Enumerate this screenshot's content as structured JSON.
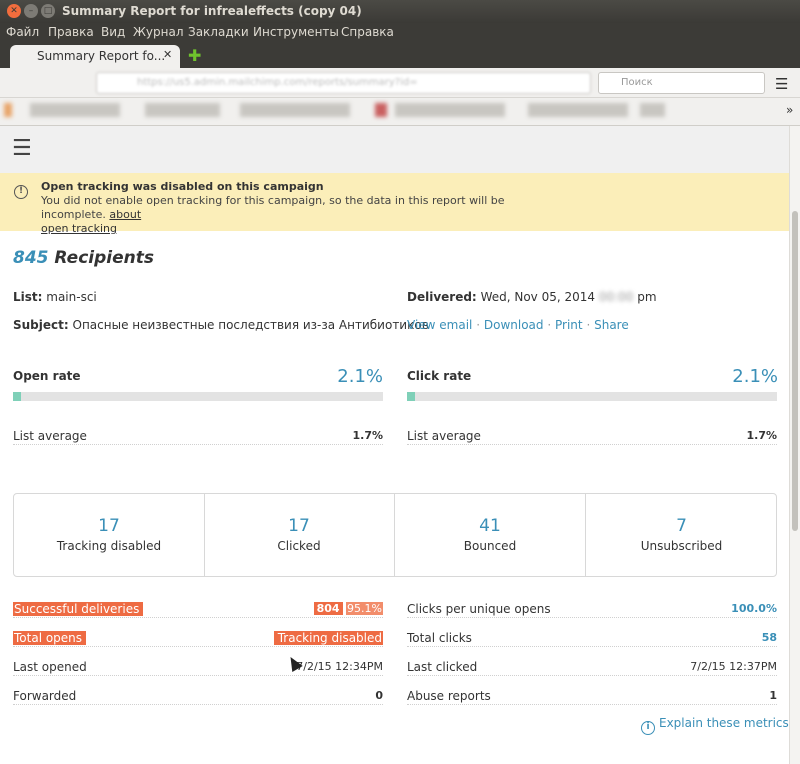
{
  "window": {
    "title": "Summary Report for infrealeffects (copy 04)"
  },
  "menu": [
    "Файл",
    "Правка",
    "Вид",
    "Журнал",
    "Закладки",
    "Инструменты",
    "Справка"
  ],
  "tab": {
    "label": "Summary Report fo...",
    "close": "✕"
  },
  "nav": {
    "search_placeholder": "Поиск"
  },
  "alert": {
    "title": "Open tracking was disabled on this campaign",
    "body": "You did not enable open tracking for this campaign, so the data in this report will be incomplete.",
    "link_line1": "about",
    "link_line2": "open tracking"
  },
  "report": {
    "recipients_count": "845",
    "recipients_label": "Recipients",
    "list_label": "List:",
    "list_value": "main-sci",
    "subject_label": "Subject:",
    "subject_value": "Опасные неизвестные последствия из-за Антибиотиков",
    "delivered_label": "Delivered:",
    "delivered_value": "Wed, Nov 05, 2014",
    "delivered_suffix": "pm",
    "links": [
      "View email",
      "Download",
      "Print",
      "Share"
    ]
  },
  "open_rate": {
    "label": "Open rate",
    "value": "2.1%",
    "fill": 0.021,
    "avg_label": "List average",
    "avg_value": "1.7%"
  },
  "click_rate": {
    "label": "Click rate",
    "value": "2.1%",
    "fill": 0.021,
    "avg_label": "List average",
    "avg_value": "1.7%"
  },
  "stats": [
    {
      "num": "17",
      "label": "Tracking disabled"
    },
    {
      "num": "17",
      "label": "Clicked"
    },
    {
      "num": "41",
      "label": "Bounced"
    },
    {
      "num": "7",
      "label": "Unsubscribed"
    }
  ],
  "left_metrics": {
    "successful_deliveries": {
      "label": "Successful deliveries",
      "count": "804",
      "pct": "95.1%"
    },
    "total_opens": {
      "label": "Total opens",
      "value": "Tracking disabled"
    },
    "last_opened": {
      "label": "Last opened",
      "value": "7/2/15 12:34PM"
    },
    "forwarded": {
      "label": "Forwarded",
      "value": "0"
    }
  },
  "right_metrics": {
    "clicks_per_unique": {
      "label": "Clicks per unique opens",
      "value": "100.0%"
    },
    "total_clicks": {
      "label": "Total clicks",
      "value": "58"
    },
    "last_clicked": {
      "label": "Last clicked",
      "value": "7/2/15 12:37PM"
    },
    "abuse_reports": {
      "label": "Abuse reports",
      "value": "1"
    }
  },
  "explain": "Explain these metrics",
  "colors": {
    "accent": "#3a8fb7",
    "highlight": "#ee6b43",
    "alert_bg": "#fbeeb9",
    "bar_fill": "#7fd0b8"
  }
}
